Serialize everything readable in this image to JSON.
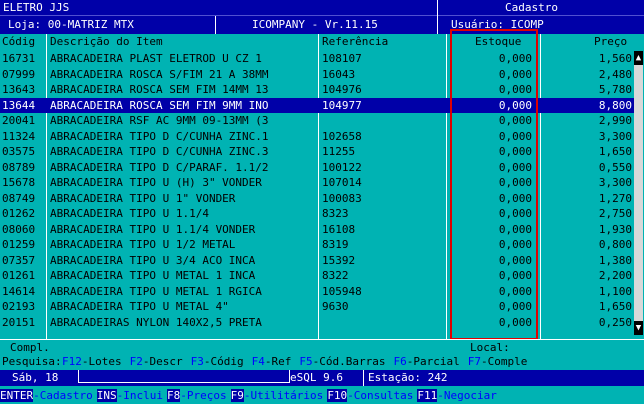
{
  "header": {
    "company": "ELETRO JJS",
    "module": "Cadastro",
    "store": "Loja: 00-MATRIZ MTX",
    "version": "ICOMPANY - Vr.11.15",
    "user": "Usuário: ICOMP"
  },
  "columns": [
    "Códig",
    "Descrição do Item",
    "Referência",
    "Estoque",
    "Preço"
  ],
  "rows": [
    {
      "code": "16731",
      "desc": "ABRACADEIRA PLAST ELETROD U CZ 1",
      "ref": "108107",
      "stock": "0,000",
      "price": "1,560"
    },
    {
      "code": "07999",
      "desc": "ABRACADEIRA ROSCA S/FIM 21 A 38MM",
      "ref": "16043",
      "stock": "0,000",
      "price": "2,480"
    },
    {
      "code": "13643",
      "desc": "ABRACADEIRA ROSCA SEM FIM 14MM 13",
      "ref": "104976",
      "stock": "0,000",
      "price": "5,780"
    },
    {
      "code": "13644",
      "desc": "ABRACADEIRA ROSCA SEM FIM 9MM INO",
      "ref": "104977",
      "stock": "0,000",
      "price": "8,800"
    },
    {
      "code": "20041",
      "desc": "ABRACADEIRA RSF AC 9MM 09-13MM (3",
      "ref": "",
      "stock": "0,000",
      "price": "2,990"
    },
    {
      "code": "11324",
      "desc": "ABRACADEIRA TIPO D C/CUNHA ZINC.1",
      "ref": "102658",
      "stock": "0,000",
      "price": "3,300"
    },
    {
      "code": "03575",
      "desc": "ABRACADEIRA TIPO D C/CUNHA ZINC.3",
      "ref": "11255",
      "stock": "0,000",
      "price": "1,650"
    },
    {
      "code": "08789",
      "desc": "ABRACADEIRA TIPO D C/PARAF. 1.1/2",
      "ref": "100122",
      "stock": "0,000",
      "price": "0,550"
    },
    {
      "code": "15678",
      "desc": "ABRACADEIRA TIPO U (H) 3\" VONDER",
      "ref": "107014",
      "stock": "0,000",
      "price": "3,300"
    },
    {
      "code": "08749",
      "desc": "ABRACADEIRA TIPO U 1\" VONDER",
      "ref": "100083",
      "stock": "0,000",
      "price": "1,270"
    },
    {
      "code": "01262",
      "desc": "ABRACADEIRA TIPO U 1.1/4",
      "ref": "8323",
      "stock": "0,000",
      "price": "2,750"
    },
    {
      "code": "08060",
      "desc": "ABRACADEIRA TIPO U 1.1/4 VONDER",
      "ref": "16108",
      "stock": "0,000",
      "price": "1,930"
    },
    {
      "code": "01259",
      "desc": "ABRACADEIRA TIPO U 1/2 METAL",
      "ref": "8319",
      "stock": "0,000",
      "price": "0,800"
    },
    {
      "code": "07357",
      "desc": "ABRACADEIRA TIPO U 3/4 ACO INCA",
      "ref": "15392",
      "stock": "0,000",
      "price": "1,380"
    },
    {
      "code": "01261",
      "desc": "ABRACADEIRA TIPO U METAL 1 INCA",
      "ref": "8322",
      "stock": "0,000",
      "price": "2,200"
    },
    {
      "code": "14614",
      "desc": "ABRACADEIRA TIPO U METAL 1 RGICA",
      "ref": "105948",
      "stock": "0,000",
      "price": "1,100"
    },
    {
      "code": "02193",
      "desc": "ABRACADEIRA TIPO U METAL 4\"",
      "ref": "9630",
      "stock": "0,000",
      "price": "1,650"
    },
    {
      "code": "20151",
      "desc": "ABRACADEIRAS NYLON 140X2,5 PRETA",
      "ref": "",
      "stock": "0,000",
      "price": "0,250"
    }
  ],
  "selected_row": 3,
  "compl_label": "Compl.",
  "local_label": "Local:",
  "search": {
    "label": "Pesquisa:",
    "keys": [
      {
        "key": "F12",
        "action": "-Lotes"
      },
      {
        "key": "F2",
        "action": "-Descr"
      },
      {
        "key": "F3",
        "action": "-Códig"
      },
      {
        "key": "F4",
        "action": "-Ref"
      },
      {
        "key": "F5",
        "action": "-Cód.Barras"
      },
      {
        "key": "F6",
        "action": "-Parcial"
      },
      {
        "key": "F7",
        "action": "-Comple"
      }
    ]
  },
  "status": {
    "day": "Sáb, 18",
    "db": "eSQL 9.6",
    "station": "Estação: 242"
  },
  "fkeys": [
    {
      "key": "ENTER",
      "action": "-Cadastro"
    },
    {
      "key": "INS",
      "action": "-Inclui"
    },
    {
      "key": "F8",
      "action": "-Preços"
    },
    {
      "key": "F9",
      "action": "-Utilitários"
    },
    {
      "key": "F10",
      "action": "-Consultas"
    },
    {
      "key": "F11",
      "action": "-Negociar"
    }
  ],
  "colors": {
    "navy": "#0000a8",
    "teal": "#00b3b3",
    "highlight": "#e00000"
  }
}
